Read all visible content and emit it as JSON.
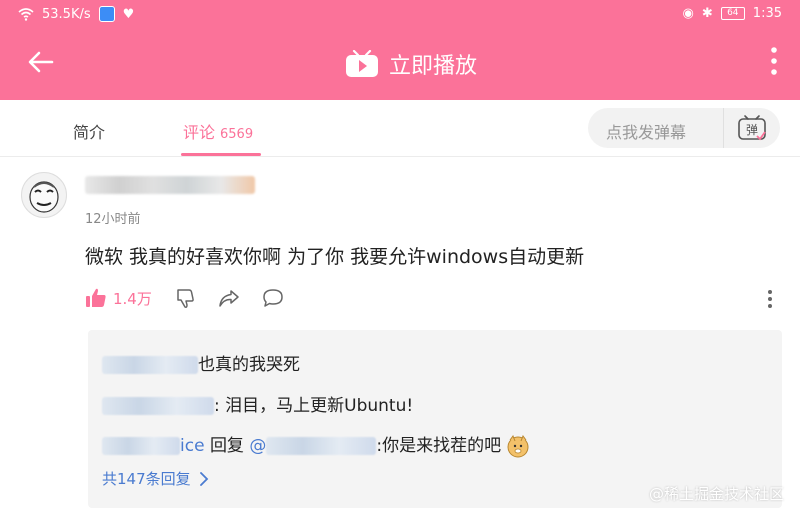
{
  "status_bar": {
    "speed": "53.5K/s",
    "battery": "64",
    "time": "1:35"
  },
  "header": {
    "play_label": "立即播放"
  },
  "tabs": {
    "intro": "简介",
    "comments": "评论",
    "comment_count": "6569"
  },
  "danmaku": {
    "placeholder": "点我发弹幕",
    "button_label": "弹"
  },
  "comment": {
    "time": "12小时前",
    "text": "微软  我真的好喜欢你啊  为了你  我要允许windows自动更新",
    "like_count": "1.4万"
  },
  "replies": [
    {
      "text": "也真的我哭死"
    },
    {
      "text": ": 泪目，马上更新Ubuntu!"
    },
    {
      "name_tail": "ice",
      "reply_word": "回复",
      "mention": "@",
      "text": ":你是来找茬的吧"
    }
  ],
  "more_replies": "共147条回复",
  "watermark": "@稀土掘金技术社区",
  "colors": {
    "accent": "#fb7299",
    "link": "#4a7bd0"
  },
  "icons": [
    "wifi-icon",
    "back-arrow-icon",
    "tv-icon",
    "more-vert-icon",
    "thumb-up-icon",
    "thumb-down-icon",
    "share-icon",
    "chat-icon",
    "chevron-right-icon",
    "doge-emoji-icon"
  ]
}
